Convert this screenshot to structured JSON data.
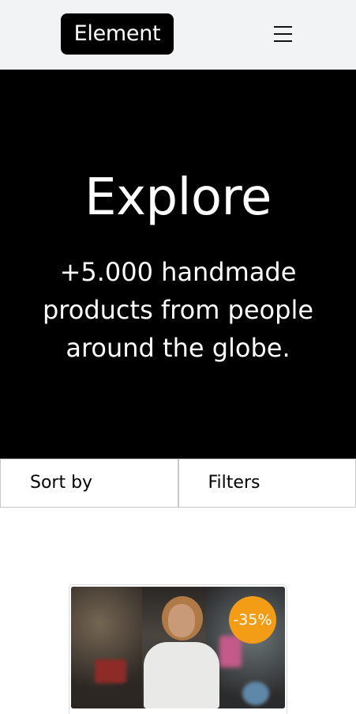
{
  "header": {
    "logo_text": "Element",
    "menu_icon": "hamburger-menu-icon"
  },
  "hero": {
    "title": "Explore",
    "subtitle": "+5.000 handmade products from people around the globe."
  },
  "controls": {
    "sort_label": "Sort by",
    "filters_label": "Filters"
  },
  "products": [
    {
      "discount_badge": "-35%",
      "badge_color": "#f39c16"
    }
  ],
  "colors": {
    "topbar_bg": "#f2f3f5",
    "hero_bg": "#000000",
    "accent": "#f39c16"
  }
}
